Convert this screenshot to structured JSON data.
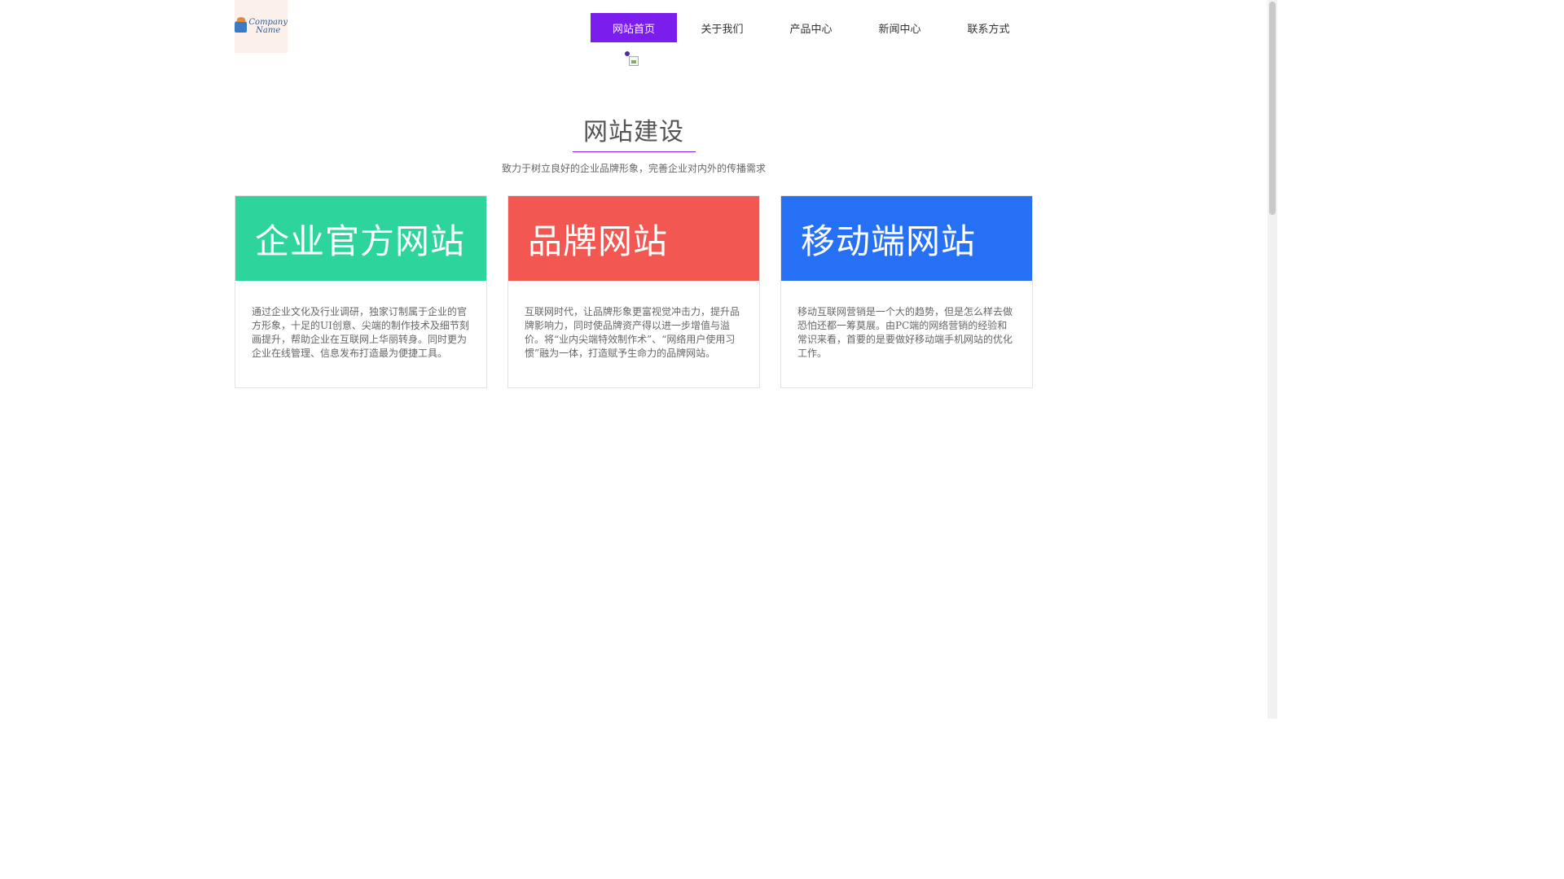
{
  "logo": {
    "line1": "Company",
    "line2": "Name"
  },
  "nav": {
    "items": [
      {
        "label": "网站首页",
        "active": true
      },
      {
        "label": "关于我们"
      },
      {
        "label": "产品中心"
      },
      {
        "label": "新闻中心"
      },
      {
        "label": "联系方式"
      }
    ]
  },
  "section": {
    "title": "网站建设",
    "subtitle": "致力于树立良好的企业品牌形象，完善企业对内外的传播需求"
  },
  "cards": [
    {
      "title": "企业官方网站",
      "color": "#2dd49b",
      "text": "通过企业文化及行业调研，独家订制属于企业的官方形象，十足的UI创意、尖端的制作技术及细节刻画提升，帮助企业在互联网上华丽转身。同时更为企业在线管理、信息发布打造最为便捷工具。"
    },
    {
      "title": "品牌网站",
      "color": "#f25851",
      "text": "互联网时代，让品牌形象更富视觉冲击力，提升品牌影响力，同时使品牌资产得以进一步增值与溢价。将“业内尖端特效制作术”、“网络用户使用习惯”融为一体，打造赋予生命力的品牌网站。"
    },
    {
      "title": "移动端网站",
      "color": "#2670f5",
      "text": "移动互联网营销是一个大的趋势，但是怎么样去做恐怕还都一筹莫展。由PC端的网络营销的经验和常识来看，首要的是要做好移动端手机网站的优化工作。"
    }
  ]
}
